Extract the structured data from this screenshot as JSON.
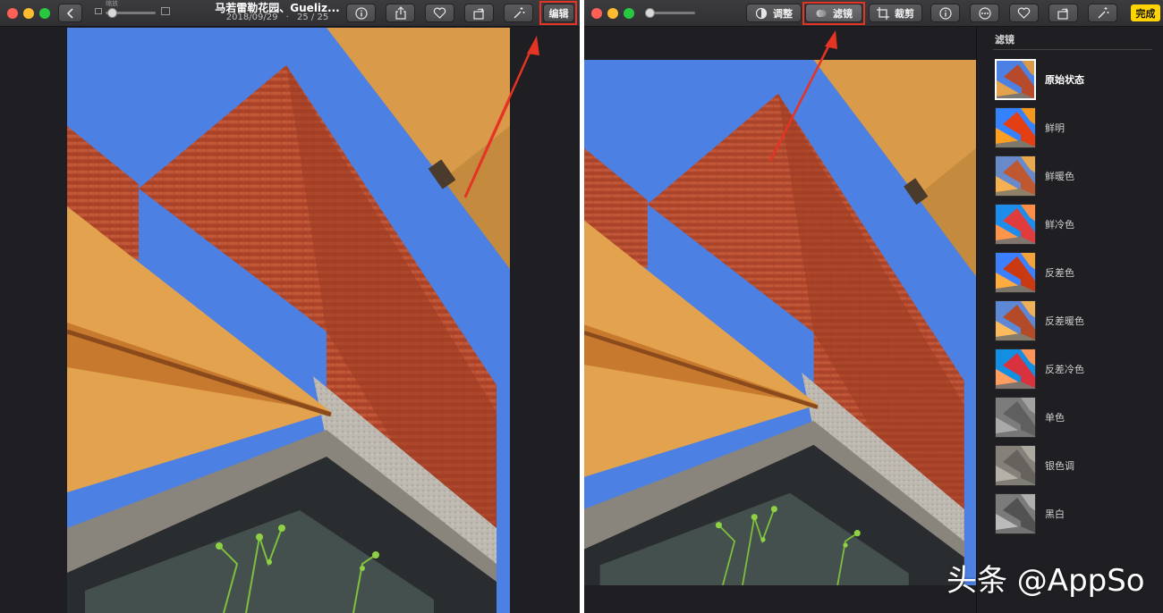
{
  "left": {
    "title": "马若雷勒花园、Gueliz...",
    "date": "2018/09/29",
    "counter": "25 / 25",
    "zoom_label": "缩放",
    "edit_label": "编辑"
  },
  "right": {
    "tabs": [
      {
        "label": "调整",
        "icon": "adjust-icon"
      },
      {
        "label": "滤镜",
        "icon": "filter-icon"
      },
      {
        "label": "裁剪",
        "icon": "crop-icon"
      }
    ],
    "done_label": "完成",
    "sidebar": {
      "title": "滤镜",
      "filters": [
        {
          "label": "原始状态",
          "selected": true
        },
        {
          "label": "鲜明"
        },
        {
          "label": "鲜暖色"
        },
        {
          "label": "鲜冷色"
        },
        {
          "label": "反差色"
        },
        {
          "label": "反差暖色"
        },
        {
          "label": "反差冷色"
        },
        {
          "label": "单色"
        },
        {
          "label": "银色调"
        },
        {
          "label": "黑白"
        }
      ]
    }
  },
  "watermark": "头条 @AppSo",
  "colors": {
    "highlight": "#e53424",
    "done": "#ffd400",
    "sky": "#4a7fe0",
    "brick": "#b84a2c",
    "awning": "#e0a050"
  }
}
